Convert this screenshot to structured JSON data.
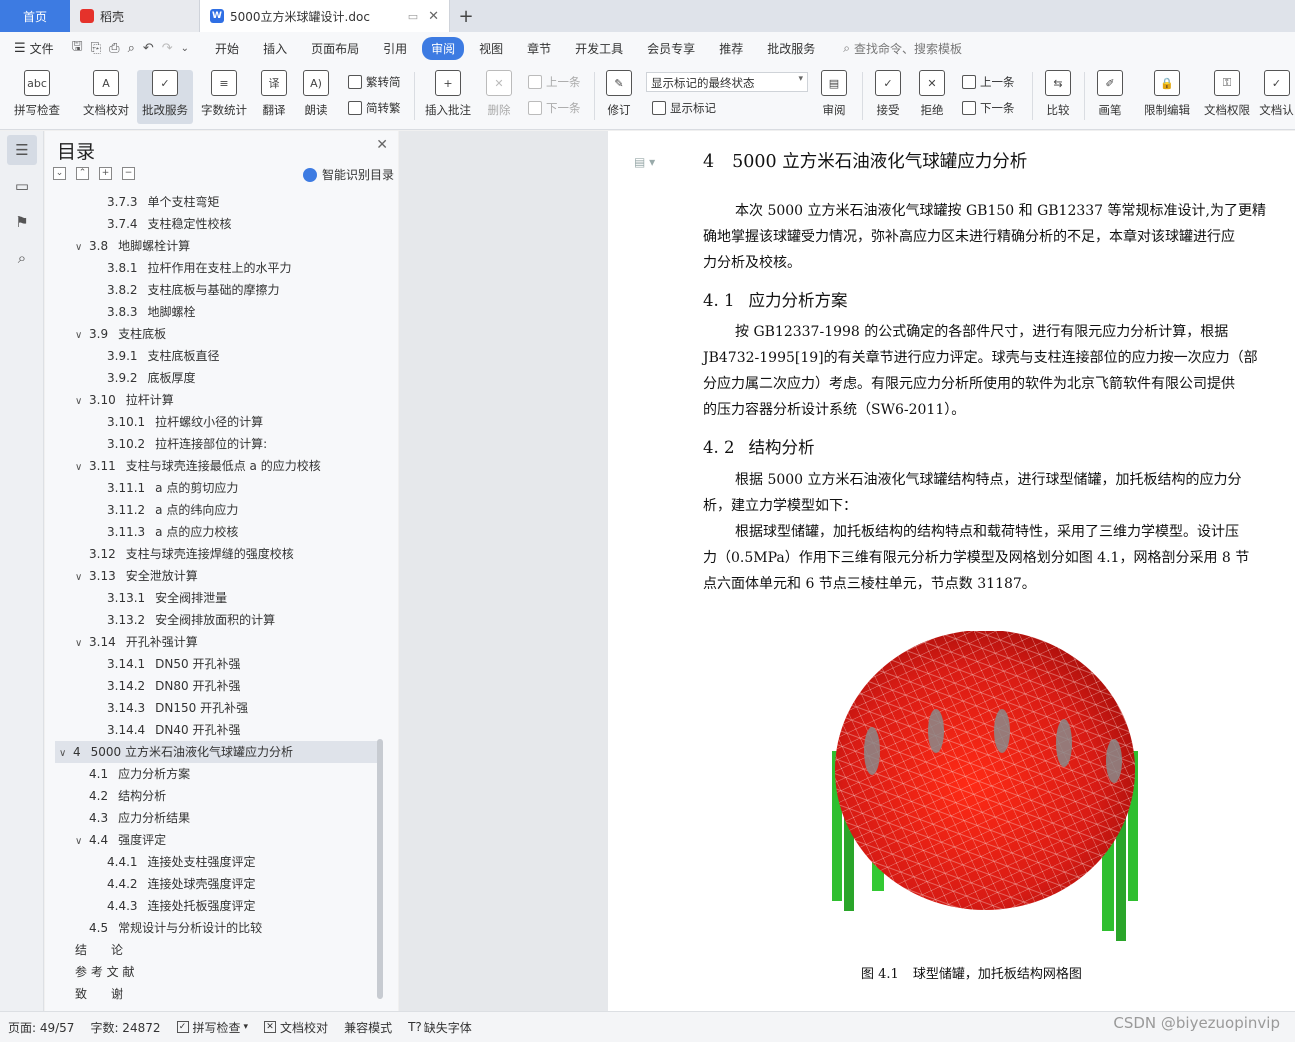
{
  "tabs": {
    "home": "首页",
    "docker": "稻壳",
    "document": "5000立方米球罐设计.doc"
  },
  "menu": {
    "file": "文件",
    "items": [
      "开始",
      "插入",
      "页面布局",
      "引用",
      "审阅",
      "视图",
      "章节",
      "开发工具",
      "会员专享",
      "推荐",
      "批改服务"
    ],
    "active": "审阅",
    "search_placeholder": "查找命令、搜索模板"
  },
  "ribbon": {
    "spell_check": "拼写检查",
    "doc_check": "文档校对",
    "revise_service": "批改服务",
    "word_count": "字数统计",
    "translate": "翻译",
    "read_aloud": "朗读",
    "trad_to_simp": "繁转简",
    "simp_to_trad": "简转繁",
    "insert_comment": "插入批注",
    "delete": "删除",
    "prev_comment": "上一条",
    "next_comment": "下一条",
    "track_changes": "修订",
    "markup_state": "显示标记的最终状态",
    "show_markup": "显示标记",
    "review": "审阅",
    "accept": "接受",
    "reject": "拒绝",
    "prev_change": "上一条",
    "next_change": "下一条",
    "compare": "比较",
    "pen": "画笔",
    "restrict_edit": "限制编辑",
    "doc_permission": "文档权限",
    "doc_cert": "文档认"
  },
  "toc": {
    "title": "目录",
    "smart": "智能识别目录",
    "items": [
      {
        "num": "3.7.3",
        "text": "单个支柱弯矩",
        "level": 3
      },
      {
        "num": "3.7.4",
        "text": "支柱稳定性校核",
        "level": 3
      },
      {
        "num": "3.8",
        "text": "地脚螺栓计算",
        "level": 2,
        "open": true
      },
      {
        "num": "3.8.1",
        "text": "拉杆作用在支柱上的水平力",
        "level": 3
      },
      {
        "num": "3.8.2",
        "text": "支柱底板与基础的摩擦力",
        "level": 3
      },
      {
        "num": "3.8.3",
        "text": "地脚螺栓",
        "level": 3
      },
      {
        "num": "3.9",
        "text": "支柱底板",
        "level": 2,
        "open": true
      },
      {
        "num": "3.9.1",
        "text": "支柱底板直径",
        "level": 3
      },
      {
        "num": "3.9.2",
        "text": "底板厚度",
        "level": 3
      },
      {
        "num": "3.10",
        "text": "拉杆计算",
        "level": 2,
        "open": true
      },
      {
        "num": "3.10.1",
        "text": "拉杆螺纹小径的计算",
        "level": 3
      },
      {
        "num": "3.10.2",
        "text": "拉杆连接部位的计算:",
        "level": 3
      },
      {
        "num": "3.11",
        "text": "支柱与球壳连接最低点 a 的应力校核",
        "level": 2,
        "open": true
      },
      {
        "num": "3.11.1",
        "text": "a 点的剪切应力",
        "level": 3
      },
      {
        "num": "3.11.2",
        "text": "a 点的纬向应力",
        "level": 3
      },
      {
        "num": "3.11.3",
        "text": "a 点的应力校核",
        "level": 3
      },
      {
        "num": "3.12",
        "text": "支柱与球壳连接焊缝的强度校核",
        "level": 2
      },
      {
        "num": "3.13",
        "text": "安全泄放计算",
        "level": 2,
        "open": true
      },
      {
        "num": "3.13.1",
        "text": "安全阀排泄量",
        "level": 3
      },
      {
        "num": "3.13.2",
        "text": "安全阀排放面积的计算",
        "level": 3
      },
      {
        "num": "3.14",
        "text": "开孔补强计算",
        "level": 2,
        "open": true
      },
      {
        "num": "3.14.1",
        "text": "DN50 开孔补强",
        "level": 3
      },
      {
        "num": "3.14.2",
        "text": "DN80 开孔补强",
        "level": 3
      },
      {
        "num": "3.14.3",
        "text": "DN150 开孔补强",
        "level": 3
      },
      {
        "num": "3.14.4",
        "text": "DN40 开孔补强",
        "level": 3
      },
      {
        "num": "4",
        "text": "5000 立方米石油液化气球罐应力分析",
        "level": 1,
        "open": true,
        "highlight": true
      },
      {
        "num": "4.1",
        "text": "应力分析方案",
        "level": 2
      },
      {
        "num": "4.2",
        "text": "结构分析",
        "level": 2
      },
      {
        "num": "4.3",
        "text": "应力分析结果",
        "level": 2
      },
      {
        "num": "4.4",
        "text": "强度评定",
        "level": 2,
        "open": true
      },
      {
        "num": "4.4.1",
        "text": "连接处支柱强度评定",
        "level": 3
      },
      {
        "num": "4.4.2",
        "text": "连接处球壳强度评定",
        "level": 3
      },
      {
        "num": "4.4.3",
        "text": "连接处托板强度评定",
        "level": 3
      },
      {
        "num": "4.5",
        "text": "常规设计与分析设计的比较",
        "level": 2
      },
      {
        "num": "",
        "text": "结　　论",
        "level": 0
      },
      {
        "num": "",
        "text": "参 考 文 献",
        "level": 0
      },
      {
        "num": "",
        "text": "致　　谢",
        "level": 0
      }
    ]
  },
  "document": {
    "heading": {
      "num": "4",
      "text": "5000 立方米石油液化气球罐应力分析"
    },
    "intro": [
      "本次 5000 立方米石油液化气球罐按 GB150 和 GB12337 等常规标准设计,为了更精",
      "确地掌握该球罐受力情况，弥补高应力区未进行精确分析的不足，本章对该球罐进行应",
      "力分析及校核。"
    ],
    "s1": {
      "num": "4. 1",
      "text": "应力分析方案"
    },
    "s1_text": [
      "按 GB12337-1998 的公式确定的各部件尺寸，进行有限元应力分析计算，根据",
      "JB4732-1995[19]的有关章节进行应力评定。球壳与支柱连接部位的应力按一次应力（部",
      "分应力属二次应力）考虑。有限元应力分析所使用的软件为北京飞箭软件有限公司提供",
      "的压力容器分析设计系统（SW6-2011）。"
    ],
    "s2": {
      "num": "4. 2",
      "text": "结构分析"
    },
    "s2_text": [
      "根据 5000 立方米石油液化气球罐结构特点，进行球型储罐，加托板结构的应力分",
      "析，建立力学模型如下：",
      "根据球型储罐，加托板结构的结构特点和载荷特性，采用了三维力学模型。设计压",
      "力（0.5MPa）作用下三维有限元分析力学模型及网格划分如图 4.1，网格剖分采用 8 节",
      "点六面体单元和 6 节点三棱柱单元，节点数 31187。"
    ],
    "caption_num": "图 4.1",
    "caption_text": "球型储罐，加托板结构网格图"
  },
  "status": {
    "page": "页面: 49/57",
    "words": "字数: 24872",
    "spell": "拼写检查",
    "doc_check": "文档校对",
    "compat": "兼容模式",
    "missing_font": "缺失字体"
  },
  "watermark": "CSDN @biyezuopinvip",
  "colors": {
    "accent": "#3d7be2",
    "sphere": "#e0201a",
    "legs": "#2fbf2f"
  }
}
